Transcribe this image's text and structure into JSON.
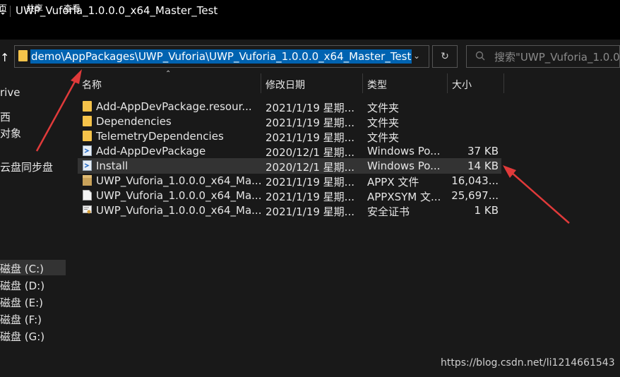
{
  "window": {
    "title": "UWP_Vuforia_1.0.0.0_x64_Master_Test"
  },
  "ribbon": {
    "tabs": [
      "页",
      "共享",
      "查看"
    ]
  },
  "address": {
    "path": "demo\\AppPackages\\UWP_Vuforia\\UWP_Vuforia_1.0.0.0_x64_Master_Test",
    "dropdown_icon": "chevron-down-icon",
    "refresh_icon": "refresh-icon"
  },
  "search": {
    "placeholder": "搜索\"UWP_Vuforia_1.0.0.0_x64_Master_Test\"",
    "display": "搜索\"UWP_Vuforia_1.0.0."
  },
  "nav": {
    "items": [
      "rive",
      "西",
      "对象",
      "云盘同步盘",
      "磁盘 (C:)",
      "磁盘 (D:)",
      "磁盘 (E:)",
      "磁盘 (F:)",
      "磁盘 (G:)"
    ],
    "selected": "磁盘 (C:)"
  },
  "columns": {
    "name": "名称",
    "date": "修改日期",
    "type": "类型",
    "size": "大小"
  },
  "files": [
    {
      "name": "Add-AppDevPackage.resour...",
      "date": "2021/1/19 星期...",
      "type": "文件夹",
      "size": "",
      "icon": "folder-icon"
    },
    {
      "name": "Dependencies",
      "date": "2021/1/19 星期...",
      "type": "文件夹",
      "size": "",
      "icon": "folder-icon"
    },
    {
      "name": "TelemetryDependencies",
      "date": "2021/1/19 星期...",
      "type": "文件夹",
      "size": "",
      "icon": "folder-icon"
    },
    {
      "name": "Add-AppDevPackage",
      "date": "2020/12/1 星期...",
      "type": "Windows Po...",
      "size": "37 KB",
      "icon": "powershell-file-icon"
    },
    {
      "name": "Install",
      "date": "2020/12/1 星期...",
      "type": "Windows Po...",
      "size": "14 KB",
      "icon": "powershell-file-icon"
    },
    {
      "name": "UWP_Vuforia_1.0.0.0_x64_Ma...",
      "date": "2021/1/19 星期...",
      "type": "APPX 文件",
      "size": "16,043...",
      "icon": "appx-package-icon"
    },
    {
      "name": "UWP_Vuforia_1.0.0.0_x64_Ma...",
      "date": "2021/1/19 星期...",
      "type": "APPXSYM 文...",
      "size": "25,697...",
      "icon": "generic-file-icon"
    },
    {
      "name": "UWP_Vuforia_1.0.0.0_x64_Ma...",
      "date": "2021/1/19 星期...",
      "type": "安全证书",
      "size": "1 KB",
      "icon": "certificate-icon"
    }
  ],
  "selected_row": "Install",
  "watermark": "https://blog.csdn.net/li1214661543",
  "colors": {
    "accent": "#0063b1",
    "annotation": "#e03a3a",
    "folder": "#f6c34a",
    "background": "#191919"
  }
}
